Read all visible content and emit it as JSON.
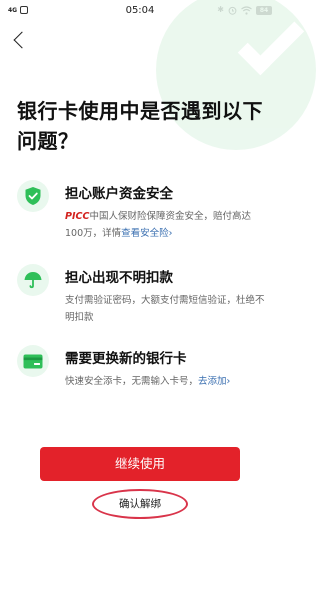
{
  "status_bar": {
    "signal": "4G",
    "time": "05:04",
    "battery": "84"
  },
  "page": {
    "title": "银行卡使用中是否遇到以下问题？"
  },
  "features": [
    {
      "icon": "shield-check-icon",
      "title": "担心账户资金安全",
      "desc_brand": "PICC",
      "desc_pre": "中国人保财险保障资金安全，赔付高达100万，详情",
      "desc_link": "查看安全险",
      "desc_suffix": "›"
    },
    {
      "icon": "umbrella-icon",
      "title": "担心出现不明扣款",
      "desc": "支付需验证密码，大额支付需短信验证，杜绝不明扣款"
    },
    {
      "icon": "bank-card-icon",
      "title": "需要更换新的银行卡",
      "desc_pre": "快速安全添卡，无需输入卡号，",
      "desc_link": "去添加",
      "desc_suffix": "›"
    }
  ],
  "actions": {
    "continue_label": "继续使用",
    "unbind_label": "确认解绑"
  },
  "colors": {
    "accent_green": "#2fbf59",
    "primary_red": "#e3222a",
    "link_blue": "#3a6fb0",
    "annotation_red": "#d9344a"
  }
}
